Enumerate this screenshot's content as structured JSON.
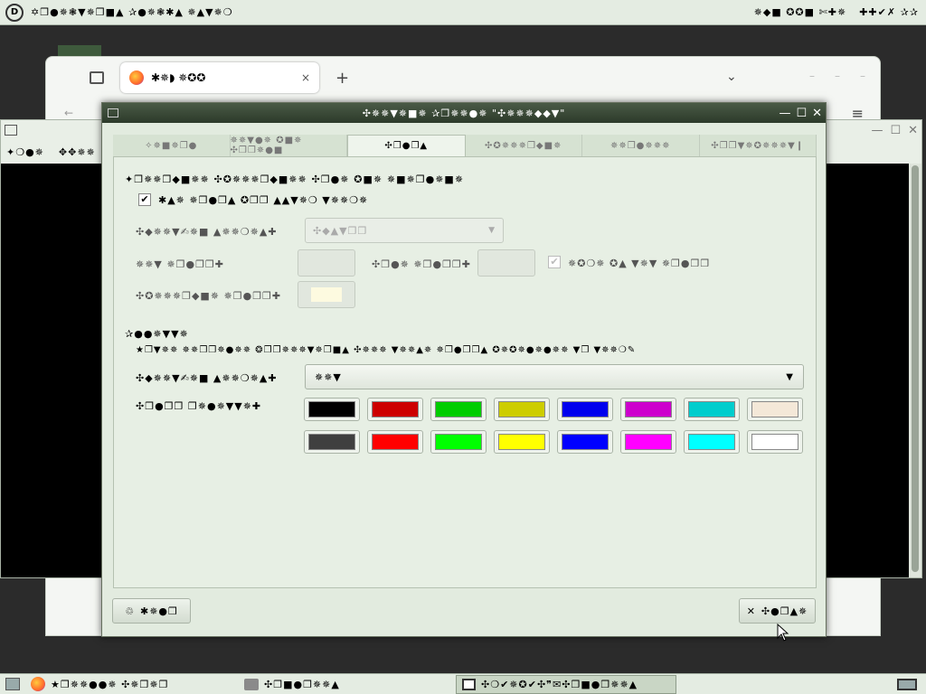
{
  "top_panel": {
    "menu_text": "✡❐●✵❃▼✵❐■▲ ✰●✵❃✱▲ ✵▲▼✵❍",
    "right_items": [
      "✵◆■ ✪✪■ ✄✚✵",
      "✚✚✔✗ ✰✰"
    ]
  },
  "browser": {
    "tab_title": "✱✵◗ ✵✪✪",
    "tab_close": "×",
    "new_tab": "+",
    "chevron": "⌄",
    "back": "←",
    "menu": "≡",
    "settings": "⚙",
    "status": "✓✵✵❍▲ ✣❐✵✵ ▲❐✵✵✚ ⇨✗✎✗ ✧✣"
  },
  "terminal": {
    "menu": [
      "✦❍●✵",
      "✥✥✵✵"
    ]
  },
  "dialog": {
    "title": "✣✵✵▼✵■✵ ✰❐✵✵●✵ \"✣✵✵✵◆◆▼\"",
    "tabs": [
      "✧✵■✵❐●",
      "✵✵▼●✵ ✪■✵ ✣❐❐✵●■",
      "✣❐●❐▲",
      "✣✪✵✵✵❐◆■✵",
      "✵✵❐●✵✵✵",
      "✣❐❐▼✵✪✵✵✵▼❙"
    ],
    "active_tab": 2,
    "section1": {
      "title": "✦❐✵✵❐◆■✵✵ ✣✪✵✵✵❐◆■✵✵ ✣❐●✵ ✪■✵ ✵■✵❐●✵■✵",
      "checkbox_label": "✱▲✵ ✵❐●❐▲ ✪❐❐ ▲▲▼✵❍ ▼✵✵❍✵",
      "builtin_label": "✣◆✵✵▼✍✵■ ▲✵✵❍✵▲✚",
      "builtin_value": "✣◆▲▼❐❐",
      "text_label": "✵✵▼ ✵❐●❐❐✚",
      "bold_label": "✣❐●✵ ✵❐●❐❐✚",
      "bold_check_label": "✵✪❍✵ ✪▲ ▼✵▼ ✵❐●❐❐",
      "bg_label": "✣✪✵✵✵❐◆■✵ ✵❐●❐❐✚",
      "text_color": "#e1e7de",
      "bold_color": "#e1e7de",
      "bg_color": "#fdfae0"
    },
    "section2": {
      "title": "✰●●✵▼▼✵",
      "hint": "★❐▼✵✵ ✵✵❐❐✵●✵✵ ❂❐❐✵✵✵▼✵❐■▲ ✣✵✵✵ ▼✵✵▲✵ ✵❐●❐❐▲ ✪✵✪✵●✵●✵✵ ▼❐ ▼✵✵❍✎",
      "builtin_label": "✣◆✵✵▼✍✵■ ▲✵✵❍✵▲✚",
      "builtin_value": "✵✵▼",
      "palette_label": "✣❐●❐❐ ❐✵●✵▼▼✵✚",
      "palette_row1": [
        "#000000",
        "#cd0000",
        "#00cd00",
        "#cdcd00",
        "#0000ee",
        "#cd00cd",
        "#00cdcd",
        "#f4e8d8"
      ],
      "palette_row2": [
        "#3f3f3f",
        "#ff0000",
        "#00ff00",
        "#ffff00",
        "#0000ff",
        "#ff00ff",
        "#00ffff",
        "#ffffff"
      ]
    },
    "help_button": "✱✵●❐",
    "close_button": "✣●❐▲✵"
  },
  "taskbar": {
    "items": [
      "★❐✵✵●●✵ ✣✵❐✵❐",
      "✣❐■●❐✵✵▲",
      "✣❍✔✵✪✔✣❞✉✣❐■●❐✵✵▲"
    ]
  }
}
